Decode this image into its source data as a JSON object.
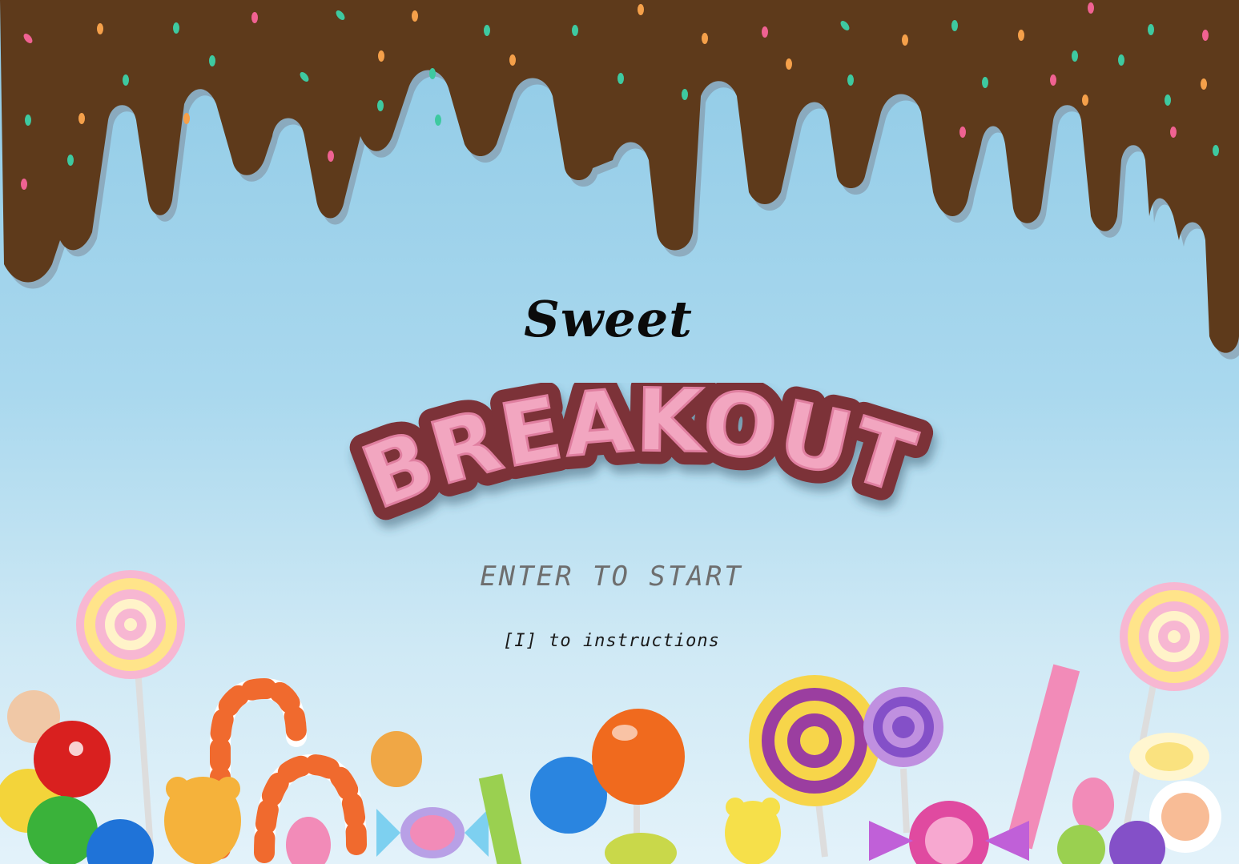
{
  "title": {
    "line1": "Sweet",
    "line2": "BREAKOUT"
  },
  "prompts": {
    "start": "ENTER TO START",
    "instructions": "[I] to instructions"
  },
  "colors": {
    "sky_top": "#8fcae6",
    "sky_bottom": "#e3f2fa",
    "chocolate": "#5e3a1b",
    "chocolate_shadow": "#7a8a99",
    "logo_fill": "#f2a6c0",
    "logo_outline": "#7b3339",
    "start_text": "#6e6e6e"
  },
  "icons": [
    "chocolate-drip",
    "sprinkles",
    "lollipop-icon",
    "gumball-icon",
    "candy-cane-icon",
    "gummy-bear-icon",
    "wrapped-candy-icon",
    "candy-stick-icon",
    "jelly-bean-icon"
  ]
}
